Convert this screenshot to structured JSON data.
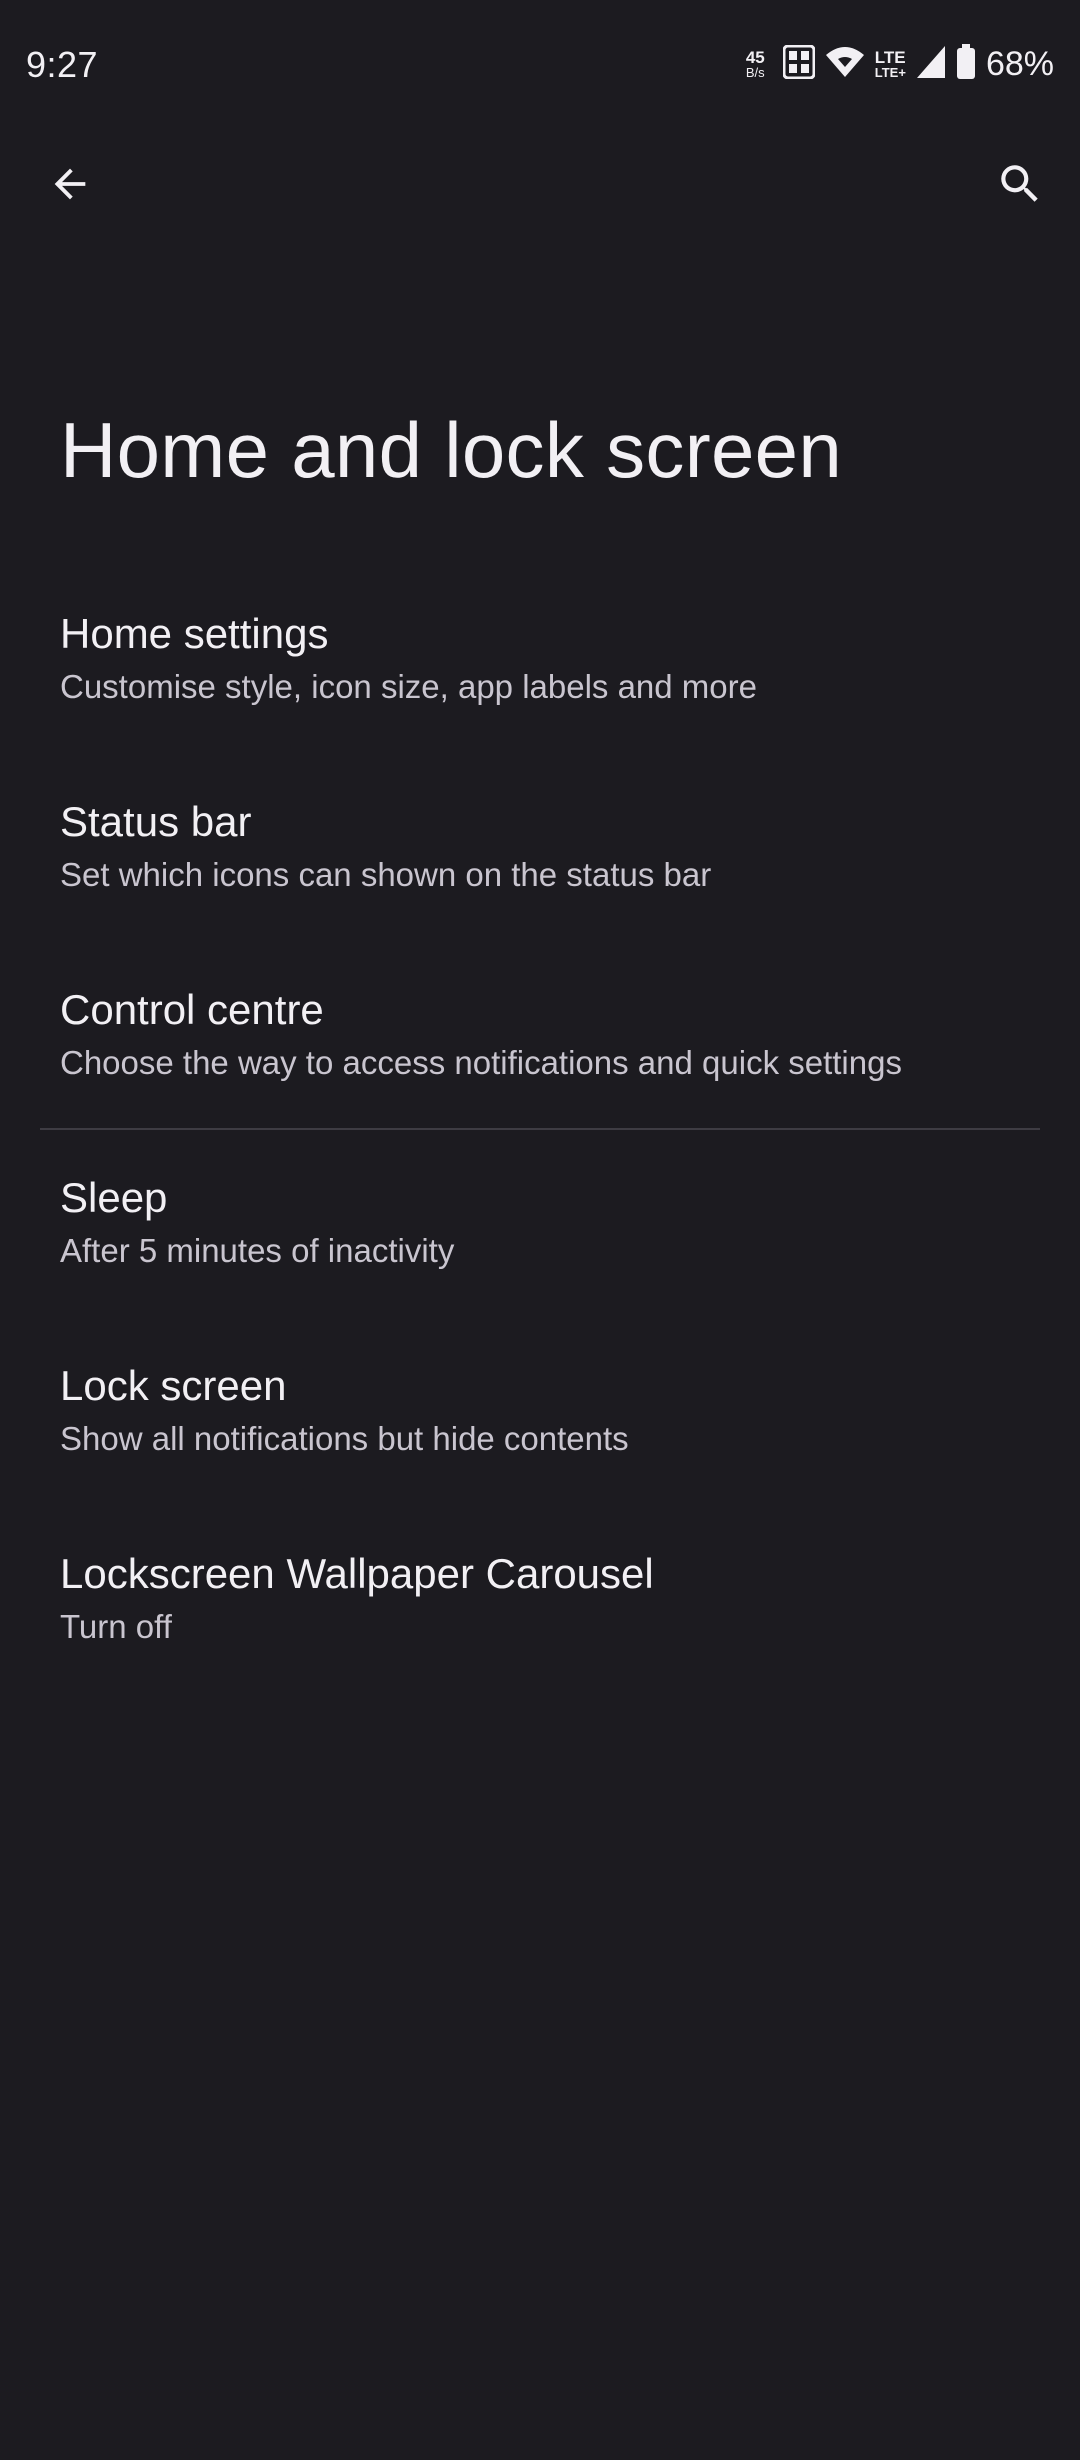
{
  "status_bar": {
    "time": "9:27",
    "net_speed_value": "45",
    "net_speed_unit": "B/s",
    "lte_top": "LTE",
    "lte_bottom": "LTE+",
    "battery_percent": "68%",
    "icons": [
      "sim-dual-icon",
      "wifi-icon",
      "signal-icon",
      "battery-icon"
    ]
  },
  "app_bar": {
    "back_icon": "arrow-back-icon",
    "search_icon": "search-icon"
  },
  "page": {
    "title": "Home and lock screen"
  },
  "settings": [
    {
      "title": "Home settings",
      "subtitle": "Customise style, icon size, app labels and more"
    },
    {
      "title": "Status bar",
      "subtitle": "Set which icons can shown on the status bar"
    },
    {
      "title": "Control centre",
      "subtitle": "Choose the way to access notifications and quick settings"
    },
    {
      "title": "Sleep",
      "subtitle": "After 5 minutes of inactivity"
    },
    {
      "title": "Lock screen",
      "subtitle": "Show all notifications but hide contents"
    },
    {
      "title": "Lockscreen Wallpaper Carousel",
      "subtitle": "Turn off"
    }
  ],
  "colors": {
    "background": "#1c1b20",
    "text_primary": "#f2f0f4",
    "text_secondary": "#c9c5cf",
    "divider": "#3e3c43"
  }
}
